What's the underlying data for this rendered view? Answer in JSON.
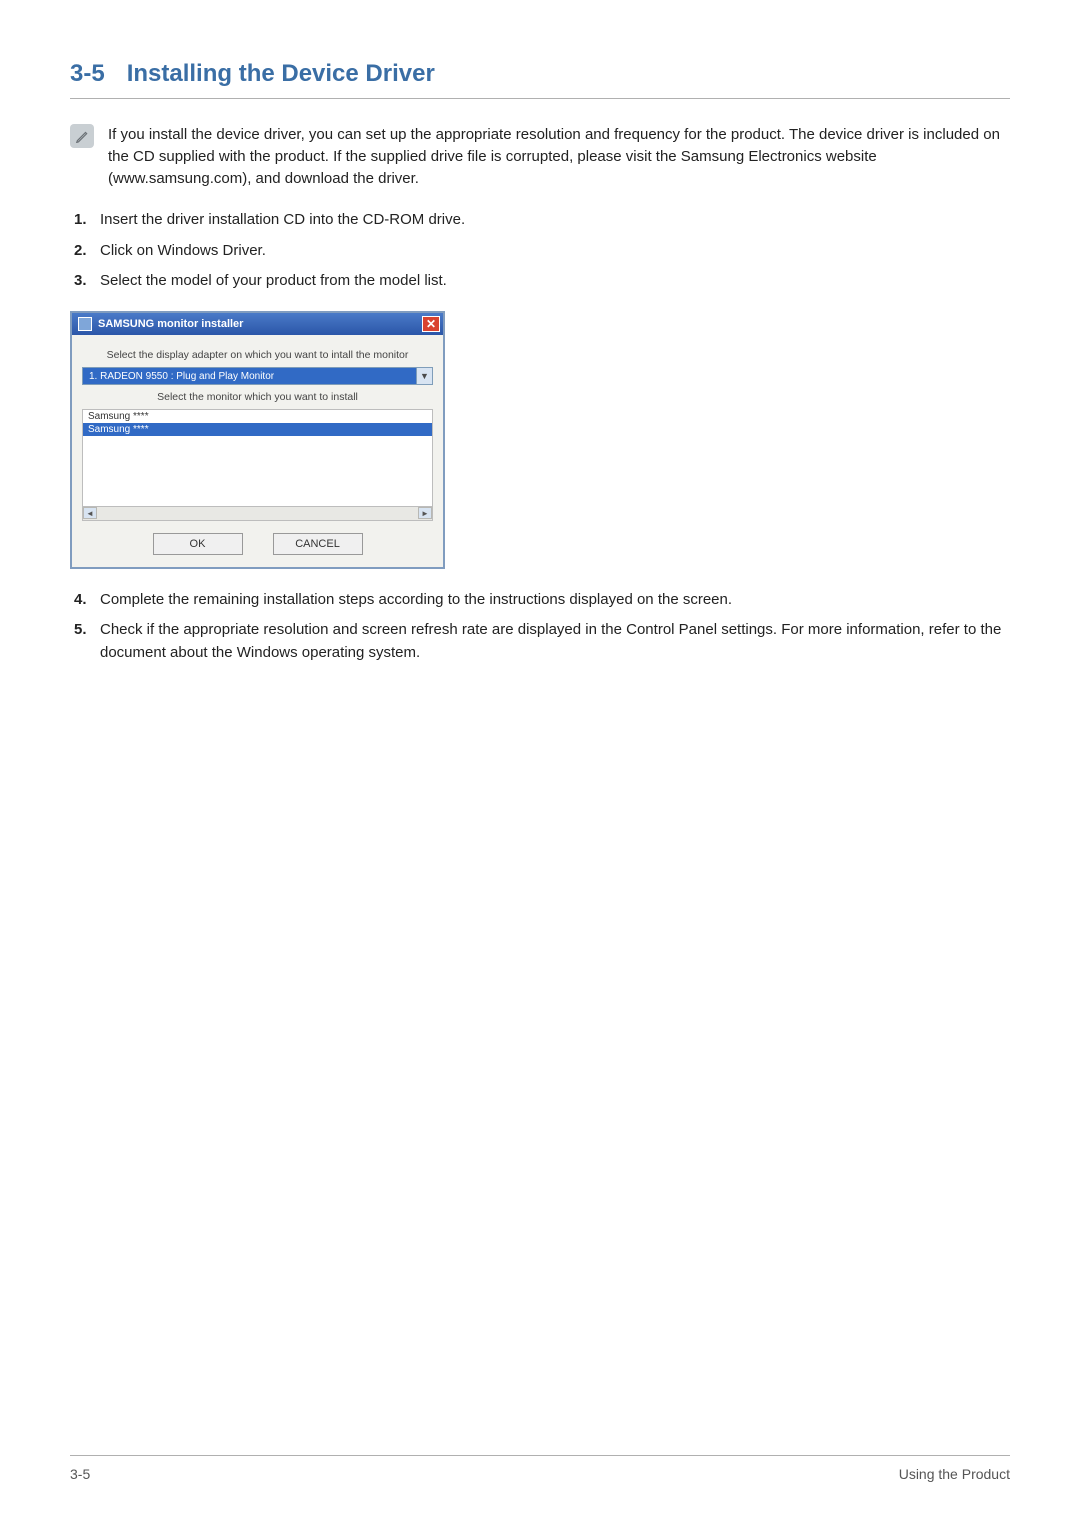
{
  "heading": {
    "number": "3-5",
    "title": "Installing the Device Driver"
  },
  "note": {
    "text": "If you install the device driver, you can set up the appropriate resolution and frequency for the product. The device driver is included on the CD supplied with the product. If the supplied drive file is corrupted, please visit the Samsung Electronics website (www.samsung.com), and download the driver."
  },
  "steps_before": [
    "Insert the driver installation CD into the CD-ROM drive.",
    "Click on Windows Driver.",
    "Select the model of your product from the model list."
  ],
  "installer": {
    "title": "SAMSUNG monitor installer",
    "label_adapter": "Select the display adapter on which you want to intall the monitor",
    "adapter_selected": "1. RADEON 9550 : Plug and Play Monitor",
    "label_monitor": "Select the monitor which you want to install",
    "list": [
      {
        "label": "Samsung ****",
        "selected": false
      },
      {
        "label": "Samsung ****",
        "selected": true
      }
    ],
    "ok": "OK",
    "cancel": "CANCEL"
  },
  "steps_after": [
    "Complete the remaining installation steps according to the instructions displayed on the screen.",
    "Check if the appropriate resolution and screen refresh rate are displayed in the Control Panel settings. For more information, refer to the document about the Windows operating system."
  ],
  "footer": {
    "left": "3-5",
    "right": "Using the Product"
  }
}
